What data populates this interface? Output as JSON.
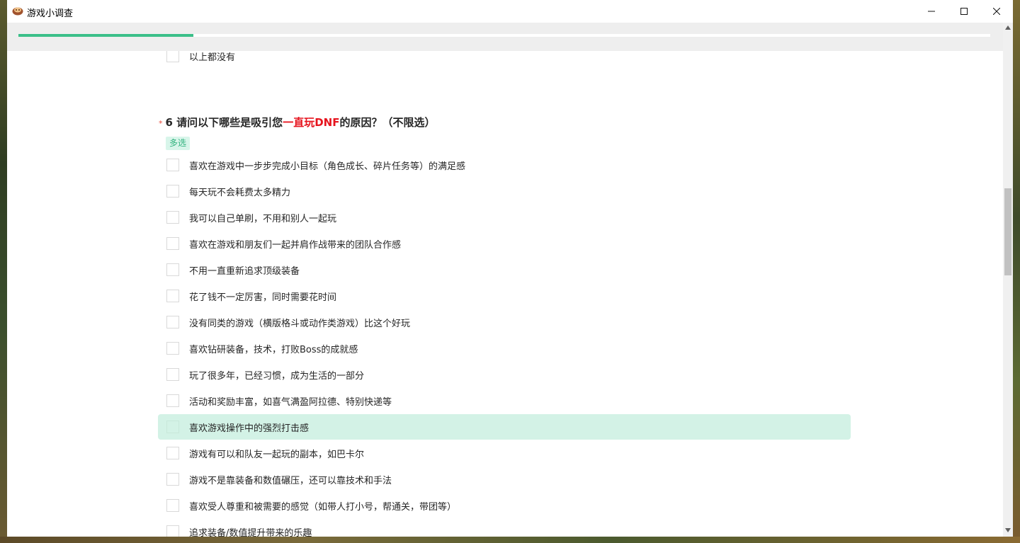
{
  "window": {
    "title": "游戏小调查",
    "app_icon": "game-app-icon",
    "controls": {
      "minimize_glyph": "—",
      "maximize_glyph": "☐",
      "close_glyph": "✕"
    }
  },
  "progress": {
    "fraction": 0.18,
    "color": "#3bbf89"
  },
  "previous_option": {
    "label": "以上都没有"
  },
  "question": {
    "required_mark": "*",
    "number": "6",
    "text_before": "请问以下哪些是吸引您",
    "text_highlight": "一直玩DNF",
    "text_after": "的原因？（不限选）",
    "highlight_color": "#e6141e",
    "type_tag": "多选",
    "options": [
      {
        "label": "喜欢在游戏中一步步完成小目标（角色成长、碎片任务等）的满足感"
      },
      {
        "label": "每天玩不会耗费太多精力"
      },
      {
        "label": "我可以自己单刷，不用和别人一起玩"
      },
      {
        "label": "喜欢在游戏和朋友们一起并肩作战带来的团队合作感"
      },
      {
        "label": "不用一直重新追求顶级装备"
      },
      {
        "label": "花了钱不一定厉害，同时需要花时间"
      },
      {
        "label": "没有同类的游戏（横版格斗或动作类游戏）比这个好玩"
      },
      {
        "label": "喜欢钻研装备，技术，打败Boss的成就感"
      },
      {
        "label": "玩了很多年，已经习惯，成为生活的一部分"
      },
      {
        "label": "活动和奖励丰富，如喜气满盈阿拉德、特别快递等"
      },
      {
        "label": "喜欢游戏操作中的强烈打击感",
        "hovered": true
      },
      {
        "label": "游戏有可以和队友一起玩的副本，如巴卡尔"
      },
      {
        "label": "游戏不是靠装备和数值碾压，还可以靠技术和手法"
      },
      {
        "label": "喜欢受人尊重和被需要的感觉（如带人打小号，帮通关，带团等）"
      },
      {
        "label": "追求装备/数值提升带来的乐趣"
      }
    ]
  },
  "accent_color": "#3bbf89",
  "hover_color": "#d3f2e6"
}
